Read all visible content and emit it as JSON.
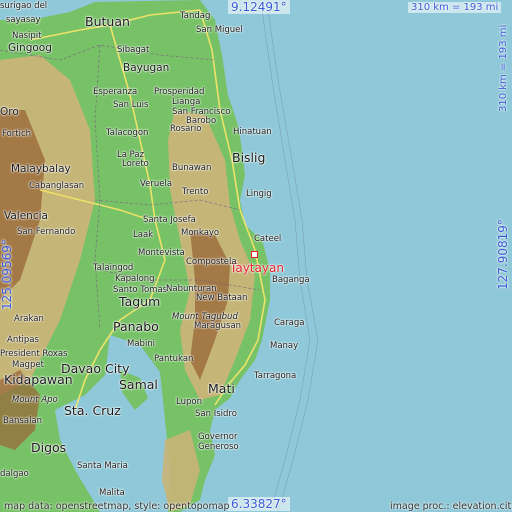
{
  "colors": {
    "sea": "#8fc8d8",
    "lowland": "#77c266",
    "hills": "#c9b478",
    "mountains": "#9a6a3a",
    "road": "#f3e46a",
    "boundary": "#7a5a8a",
    "highlight": "#e4222a",
    "coord": "#3a5bd6"
  },
  "coords": {
    "top_lat": "9.12491°",
    "bottom_lat": "6.33827°",
    "left_lon": "125.09569°",
    "right_lon": "127.90819°",
    "scale_top": "310 km = 193 mi",
    "scale_right": "310 km = 193 mi"
  },
  "highlight": {
    "name": "Taytayan",
    "icon": "square-marker-icon"
  },
  "places": {
    "surigao_del": "surigao del",
    "sayasay": "sayasay",
    "butuan": "Butuan",
    "tandag_top": "Tandag",
    "san_miguel": "San Miguel",
    "nasipit": "Nasipit",
    "gingoog": "Gingoog",
    "sibagat": "Sibagat",
    "bayugan": "Bayugan",
    "esperanza": "Esperanza",
    "prosperidad": "Prosperidad",
    "lianga": "Lianga",
    "san_luis": "San Luis",
    "san_francisco": "San Francisco",
    "barobo": "Barobo",
    "talacogon": "Talacogon",
    "rosario": "Rosario",
    "hinatuan": "Hinatuan",
    "oro": "Oro",
    "fortich": "Fortich",
    "la_paz": "La Paz",
    "loreto": "Loreto",
    "bislig": "Bislig",
    "malaybalay": "Malaybalay",
    "bunawan": "Bunawan",
    "cabanglasan": "Cabanglasan",
    "veruela": "Veruela",
    "trento": "Trento",
    "lingig": "Lingig",
    "valencia": "Valencia",
    "santa_josefa": "Santa Josefa",
    "san_fernando": "San Fernando",
    "laak": "Laak",
    "monkayo": "Monkayo",
    "cateel": "Cateel",
    "montevista": "Montevista",
    "compostela": "Compostela",
    "talaingod": "Talaingod",
    "kapalong": "Kapalong",
    "baganga": "Baganga",
    "santo_tomas": "Santo Tomas",
    "nabunturan": "Nabunturan",
    "new_bataan": "New Bataan",
    "tagum": "Tagum",
    "mount_tagubud": "Mount Tagubud",
    "arakan": "Arakan",
    "maragusan": "Maragusan",
    "panabo": "Panabo",
    "caraga": "Caraga",
    "antipas": "Antipas",
    "mabini": "Mabini",
    "manay": "Manay",
    "president_roxas": "President Roxas",
    "magpet": "Magpet",
    "pantukan": "Pantukan",
    "kidapawan": "Kidapawan",
    "davao_city": "Davao City",
    "tarragona": "Tarragona",
    "samal": "Samal",
    "mati": "Mati",
    "mount_apo": "Mount Apo",
    "lupon": "Lupon",
    "santa_cruz": "Sta. Cruz",
    "san_isidro": "San Isidro",
    "bansalan": "Bansalan",
    "governor_generoso": "Governor\nGeneroso",
    "digos": "Digos",
    "santa_maria": "Santa Maria",
    "malita": "Malita",
    "dalgao": "dalgao"
  },
  "credits": {
    "left": "map data: openstreetmap, style: opentopomap",
    "right": "image proc.: elevation.city"
  }
}
